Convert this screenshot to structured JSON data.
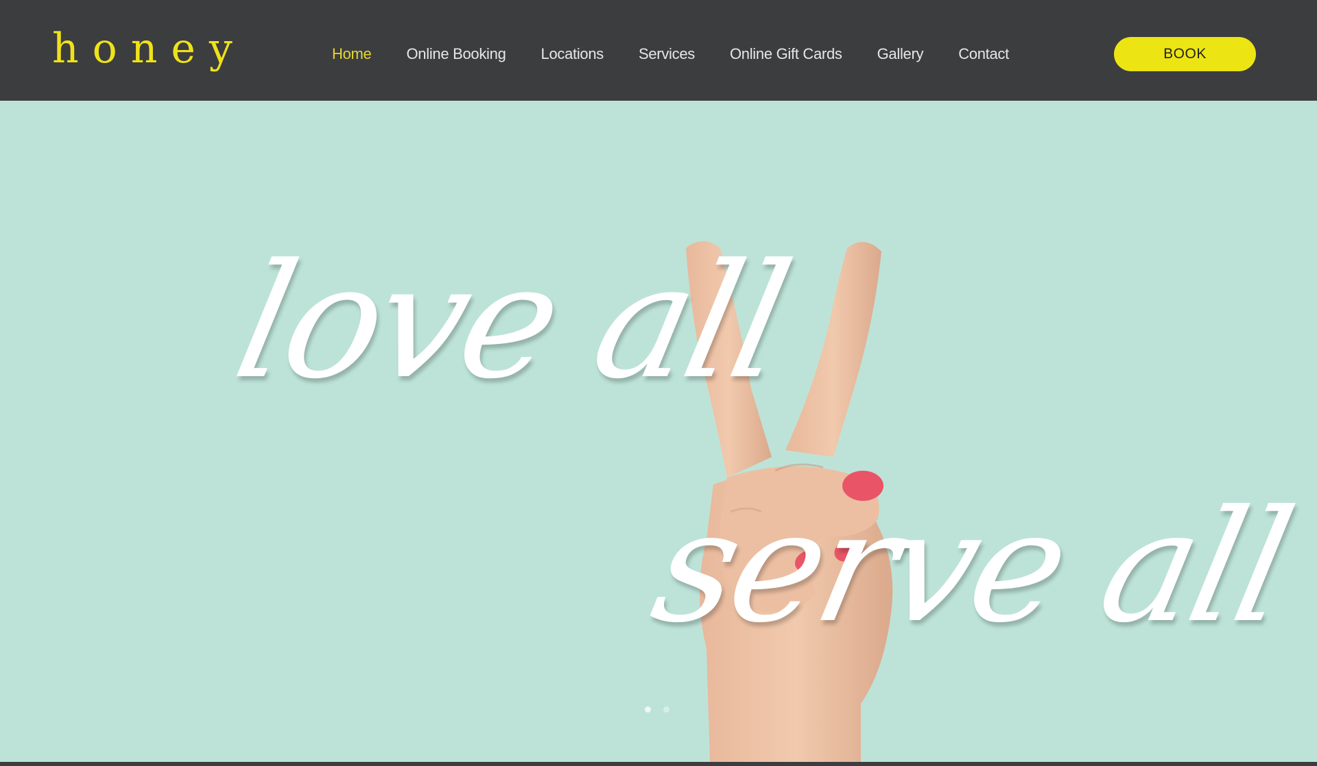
{
  "brand": {
    "logo_text": "honey"
  },
  "nav": {
    "items": [
      {
        "label": "Home",
        "active": true
      },
      {
        "label": "Online Booking"
      },
      {
        "label": "Locations"
      },
      {
        "label": "Services"
      },
      {
        "label": "Online Gift Cards"
      },
      {
        "label": "Gallery"
      },
      {
        "label": "Contact"
      }
    ]
  },
  "cta": {
    "book_label": "BOOK"
  },
  "hero": {
    "line1": "love all",
    "line2": "serve all",
    "slides": {
      "count": 2,
      "current": 1
    }
  },
  "colors": {
    "header_bg": "#3c3d3f",
    "accent_yellow": "#ede513",
    "hero_bg": "#bde3d8",
    "nail_polish": "#e95566"
  }
}
